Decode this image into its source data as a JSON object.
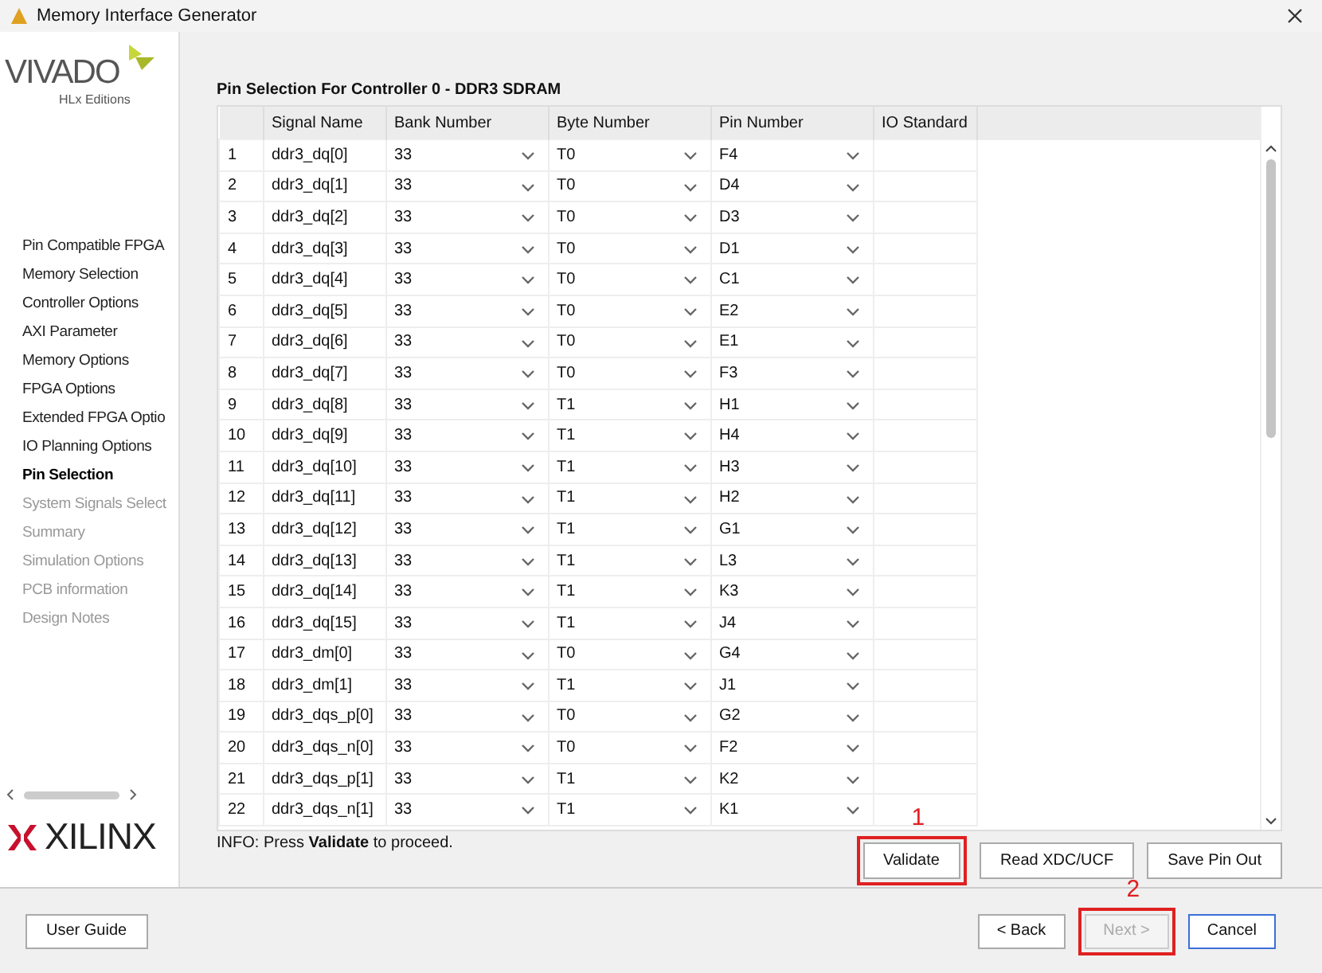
{
  "window": {
    "title": "Memory Interface Generator"
  },
  "sidebar": {
    "logo_top": "VIVADO",
    "logo_sub": "HLx Editions",
    "brand": "XILINX",
    "items": [
      {
        "label": "Pin Compatible FPGA",
        "selected": false,
        "disabled": false
      },
      {
        "label": "Memory Selection",
        "selected": false,
        "disabled": false
      },
      {
        "label": "Controller Options",
        "selected": false,
        "disabled": false
      },
      {
        "label": "AXI Parameter",
        "selected": false,
        "disabled": false
      },
      {
        "label": "Memory Options",
        "selected": false,
        "disabled": false
      },
      {
        "label": "FPGA Options",
        "selected": false,
        "disabled": false
      },
      {
        "label": "Extended FPGA Optio",
        "selected": false,
        "disabled": false
      },
      {
        "label": "IO Planning Options",
        "selected": false,
        "disabled": false
      },
      {
        "label": "Pin Selection",
        "selected": true,
        "disabled": false
      },
      {
        "label": "System Signals Select",
        "selected": false,
        "disabled": true
      },
      {
        "label": "Summary",
        "selected": false,
        "disabled": true
      },
      {
        "label": "Simulation Options",
        "selected": false,
        "disabled": true
      },
      {
        "label": "PCB information",
        "selected": false,
        "disabled": true
      },
      {
        "label": "Design Notes",
        "selected": false,
        "disabled": true
      }
    ]
  },
  "section_title": "Pin Selection For Controller 0 - DDR3 SDRAM",
  "table": {
    "columns": [
      "",
      "Signal Name",
      "Bank Number",
      "Byte Number",
      "Pin Number",
      "IO Standard"
    ],
    "rows": [
      [
        "1",
        "ddr3_dq[0]",
        "33",
        "T0",
        "F4"
      ],
      [
        "2",
        "ddr3_dq[1]",
        "33",
        "T0",
        "D4"
      ],
      [
        "3",
        "ddr3_dq[2]",
        "33",
        "T0",
        "D3"
      ],
      [
        "4",
        "ddr3_dq[3]",
        "33",
        "T0",
        "D1"
      ],
      [
        "5",
        "ddr3_dq[4]",
        "33",
        "T0",
        "C1"
      ],
      [
        "6",
        "ddr3_dq[5]",
        "33",
        "T0",
        "E2"
      ],
      [
        "7",
        "ddr3_dq[6]",
        "33",
        "T0",
        "E1"
      ],
      [
        "8",
        "ddr3_dq[7]",
        "33",
        "T0",
        "F3"
      ],
      [
        "9",
        "ddr3_dq[8]",
        "33",
        "T1",
        "H1"
      ],
      [
        "10",
        "ddr3_dq[9]",
        "33",
        "T1",
        "H4"
      ],
      [
        "11",
        "ddr3_dq[10]",
        "33",
        "T1",
        "H3"
      ],
      [
        "12",
        "ddr3_dq[11]",
        "33",
        "T1",
        "H2"
      ],
      [
        "13",
        "ddr3_dq[12]",
        "33",
        "T1",
        "G1"
      ],
      [
        "14",
        "ddr3_dq[13]",
        "33",
        "T1",
        "L3"
      ],
      [
        "15",
        "ddr3_dq[14]",
        "33",
        "T1",
        "K3"
      ],
      [
        "16",
        "ddr3_dq[15]",
        "33",
        "T1",
        "J4"
      ],
      [
        "17",
        "ddr3_dm[0]",
        "33",
        "T0",
        "G4"
      ],
      [
        "18",
        "ddr3_dm[1]",
        "33",
        "T1",
        "J1"
      ],
      [
        "19",
        "ddr3_dqs_p[0]",
        "33",
        "T0",
        "G2"
      ],
      [
        "20",
        "ddr3_dqs_n[0]",
        "33",
        "T0",
        "F2"
      ],
      [
        "21",
        "ddr3_dqs_p[1]",
        "33",
        "T1",
        "K2"
      ],
      [
        "22",
        "ddr3_dqs_n[1]",
        "33",
        "T1",
        "K1"
      ]
    ]
  },
  "info": "INFO: Press **Validate** to proceed.",
  "actions": [
    {
      "label": "Validate",
      "annotation": "1"
    },
    {
      "label": "Read XDC/UCF"
    },
    {
      "label": "Save Pin Out"
    }
  ],
  "footer": {
    "help": "User Guide",
    "buttons": [
      {
        "label": "< Back",
        "disabled": false
      },
      {
        "label": "Next >",
        "disabled": true,
        "annotation": "2"
      },
      {
        "label": "Cancel",
        "disabled": false
      }
    ]
  }
}
